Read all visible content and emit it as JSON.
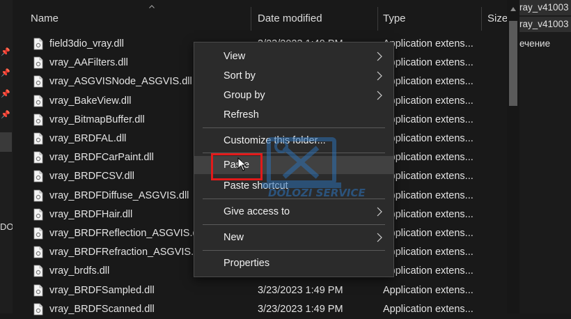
{
  "columns": {
    "name": "Name",
    "date_modified": "Date modified",
    "type": "Type",
    "size": "Size"
  },
  "files": [
    {
      "name": "field3dio_vray.dll",
      "date": "3/23/2023 1:49 PM",
      "type": "Application extens..."
    },
    {
      "name": "vray_AAFilters.dll",
      "date": "",
      "type": "Application extens..."
    },
    {
      "name": "vray_ASGVISNode_ASGVIS.dll",
      "date": "",
      "type": "Application extens..."
    },
    {
      "name": "vray_BakeView.dll",
      "date": "",
      "type": "Application extens..."
    },
    {
      "name": "vray_BitmapBuffer.dll",
      "date": "",
      "type": "Application extens..."
    },
    {
      "name": "vray_BRDFAL.dll",
      "date": "",
      "type": "Application extens..."
    },
    {
      "name": "vray_BRDFCarPaint.dll",
      "date": "",
      "type": "Application extens..."
    },
    {
      "name": "vray_BRDFCSV.dll",
      "date": "",
      "type": "Application extens..."
    },
    {
      "name": "vray_BRDFDiffuse_ASGVIS.dll",
      "date": "",
      "type": "Application extens..."
    },
    {
      "name": "vray_BRDFHair.dll",
      "date": "",
      "type": "Application extens..."
    },
    {
      "name": "vray_BRDFReflection_ASGVIS.dll",
      "date": "",
      "type": "Application extens..."
    },
    {
      "name": "vray_BRDFRefraction_ASGVIS.dll",
      "date": "",
      "type": "Application extens..."
    },
    {
      "name": "vray_brdfs.dll",
      "date": "",
      "type": "Application extens..."
    },
    {
      "name": "vray_BRDFSampled.dll",
      "date": "3/23/2023 1:49 PM",
      "type": "Application extens..."
    },
    {
      "name": "vray_BRDFScanned.dll",
      "date": "3/23/2023 1:49 PM",
      "type": "Application extens..."
    }
  ],
  "context_menu": {
    "view": "View",
    "sort_by": "Sort by",
    "group_by": "Group by",
    "refresh": "Refresh",
    "customize": "Customize this folder...",
    "paste": "Paste",
    "paste_shortcut": "Paste shortcut",
    "give_access": "Give access to",
    "new": "New",
    "properties": "Properties"
  },
  "right_panel": {
    "item1": "ray_v41003",
    "item2": "ray_v41003",
    "item3": "ечение"
  },
  "left_strip": {
    "text": "DOI"
  },
  "watermark": {
    "text": "DOLOZI SERVICE"
  },
  "colors": {
    "background": "#191919",
    "menu_background": "#2b2b2b",
    "menu_hover": "#414141",
    "highlight": "#e11a1a",
    "text": "#e6e6e6"
  },
  "icons": {
    "file": "dll-file-icon",
    "pin": "pin-icon",
    "submenu": "chevron-right-icon",
    "sort": "sort-up-icon",
    "cursor": "mouse-cursor-icon"
  }
}
